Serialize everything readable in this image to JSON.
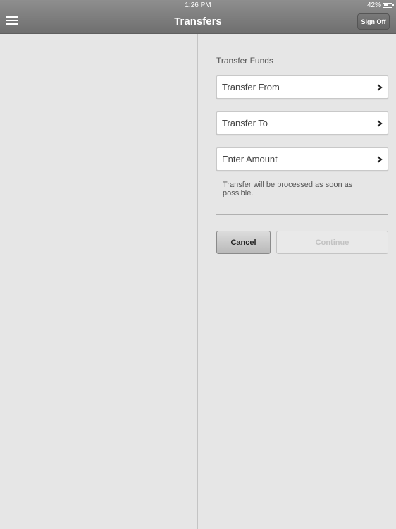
{
  "status_bar": {
    "time": "1:26 PM",
    "battery": "42%"
  },
  "header": {
    "title": "Transfers",
    "sign_off_label": "Sign Off",
    "menu_icon": "hamburger-menu-icon"
  },
  "form": {
    "section_title": "Transfer Funds",
    "fields": [
      {
        "label": "Transfer From",
        "icon": "chevron-right-icon"
      },
      {
        "label": "Transfer To",
        "icon": "chevron-right-icon"
      },
      {
        "label": "Enter Amount",
        "icon": "chevron-right-icon"
      }
    ],
    "note": "Transfer will be processed as soon as possible.",
    "cancel_label": "Cancel",
    "continue_label": "Continue"
  }
}
